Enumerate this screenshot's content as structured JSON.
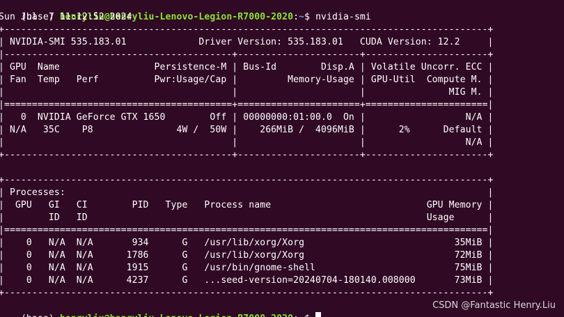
{
  "colors": {
    "background": "#300a24",
    "text": "#ffffff",
    "prompt_user": "#8ae234",
    "prompt_path": "#729fcf"
  },
  "prompt": {
    "env": "(base) ",
    "user_host": "henryliu@henryliu-Lenovo-Legion-R7000-2020",
    "sep": ":",
    "path": "~",
    "symbol": "$ ",
    "command": "nvidia-smi"
  },
  "timestamp": "Sun Jul  7 11:12:52 2024",
  "output_lines": [
    "+---------------------------------------------------------------------------------------+",
    "| NVIDIA-SMI 535.183.01             Driver Version: 535.183.01   CUDA Version: 12.2     |",
    "|-----------------------------------------+----------------------+----------------------+",
    "| GPU  Name                 Persistence-M | Bus-Id        Disp.A | Volatile Uncorr. ECC |",
    "| Fan  Temp   Perf          Pwr:Usage/Cap |         Memory-Usage | GPU-Util  Compute M. |",
    "|                                         |                      |               MIG M. |",
    "|=========================================+======================+======================|",
    "|   0  NVIDIA GeForce GTX 1650        Off | 00000000:01:00.0  On |                  N/A |",
    "| N/A   35C    P8               4W /  50W |    266MiB /  4096MiB |      2%      Default |",
    "|                                         |                      |                  N/A |",
    "+-----------------------------------------+----------------------+----------------------+",
    "",
    "+---------------------------------------------------------------------------------------+",
    "| Processes:                                                                            |",
    "|  GPU   GI   CI        PID   Type   Process name                            GPU Memory |",
    "|        ID   ID                                                             Usage      |",
    "|=======================================================================================|",
    "|    0   N/A  N/A       934      G   /usr/lib/xorg/Xorg                           35MiB |",
    "|    0   N/A  N/A      1786      G   /usr/lib/xorg/Xorg                           72MiB |",
    "|    0   N/A  N/A      1915      G   /usr/bin/gnome-shell                         75MiB |",
    "|    0   N/A  N/A      4237      G   ...seed-version=20240704-180140.008000       73MiB |",
    "+---------------------------------------------------------------------------------------+"
  ],
  "watermark": "CSDN @Fantastic Henry.Liu"
}
